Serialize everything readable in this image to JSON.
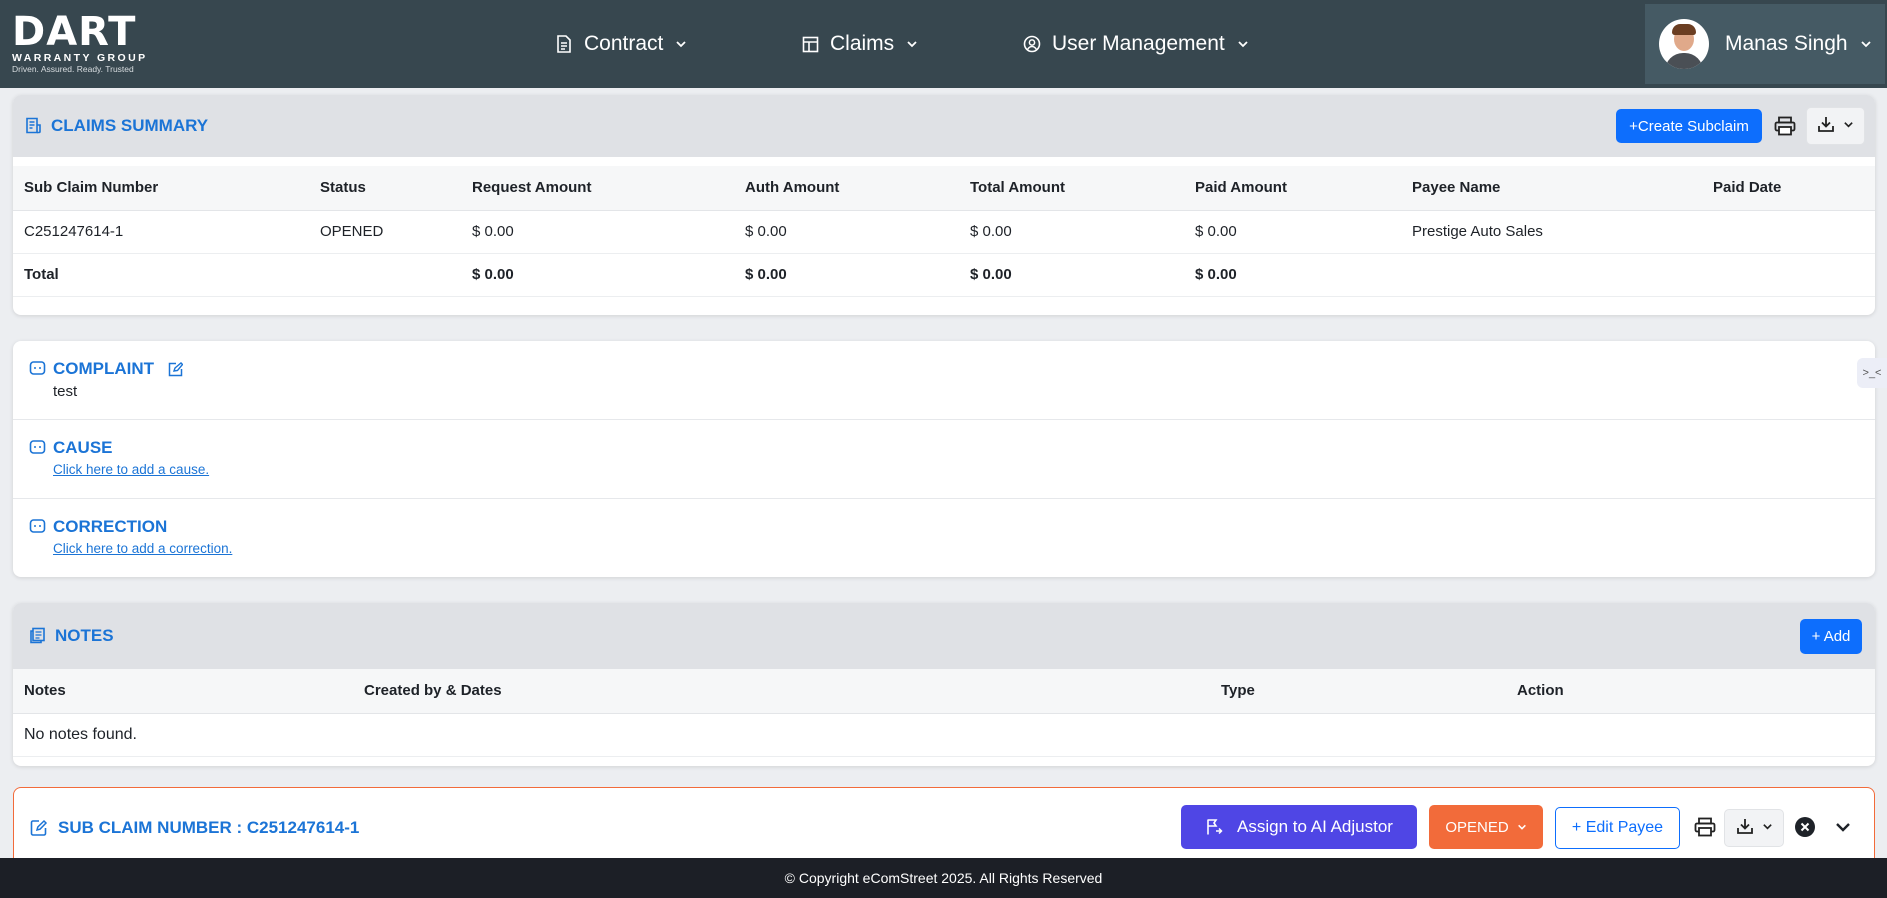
{
  "brand": {
    "logo_text": "DART",
    "logo_sub": "WARRANTY GROUP",
    "logo_tagline": "Driven. Assured. Ready. Trusted"
  },
  "nav": {
    "items": [
      {
        "label": "Contract",
        "icon": "document-icon"
      },
      {
        "label": "Claims",
        "icon": "layout-icon"
      },
      {
        "label": "User Management",
        "icon": "user-circle-icon"
      }
    ],
    "user_name": "Manas Singh"
  },
  "claims_summary": {
    "title": "CLAIMS SUMMARY",
    "create_label": "+Create Subclaim",
    "columns": [
      "Sub Claim Number",
      "Status",
      "Request Amount",
      "Auth Amount",
      "Total Amount",
      "Paid Amount",
      "Payee Name",
      "Paid Date"
    ],
    "rows": [
      [
        "C251247614-1",
        "OPENED",
        "$ 0.00",
        "$ 0.00",
        "$ 0.00",
        "$ 0.00",
        "Prestige Auto Sales",
        ""
      ]
    ],
    "total_row": [
      "Total",
      "",
      "$ 0.00",
      "$ 0.00",
      "$ 0.00",
      "$ 0.00",
      "",
      ""
    ]
  },
  "complaint": {
    "title": "COMPLAINT",
    "text": "test"
  },
  "cause": {
    "title": "CAUSE",
    "link": "Click here to add a cause."
  },
  "correction": {
    "title": "CORRECTION",
    "link": "Click here to add a correction."
  },
  "side_tab": {
    "label": ">_<"
  },
  "notes": {
    "title": "NOTES",
    "add_label": "+ Add",
    "columns": [
      "Notes",
      "Created by & Dates",
      "Type",
      "Action"
    ],
    "empty_text": "No notes found."
  },
  "sub_claim": {
    "title": "SUB CLAIM NUMBER : C251247614-1",
    "assign_label": "Assign to AI Adjustor",
    "status_label": "OPENED",
    "edit_payee_label": "+ Edit Payee"
  },
  "footer": {
    "text": "© Copyright eComStreet 2025. All Rights Reserved"
  },
  "colors": {
    "navbar": "#37474f",
    "accent_blue": "#0d6efd",
    "title_blue": "#1b74d6",
    "ai_purple": "#4f46e5",
    "status_orange": "#f26b3a",
    "footer": "#1c1f26"
  }
}
